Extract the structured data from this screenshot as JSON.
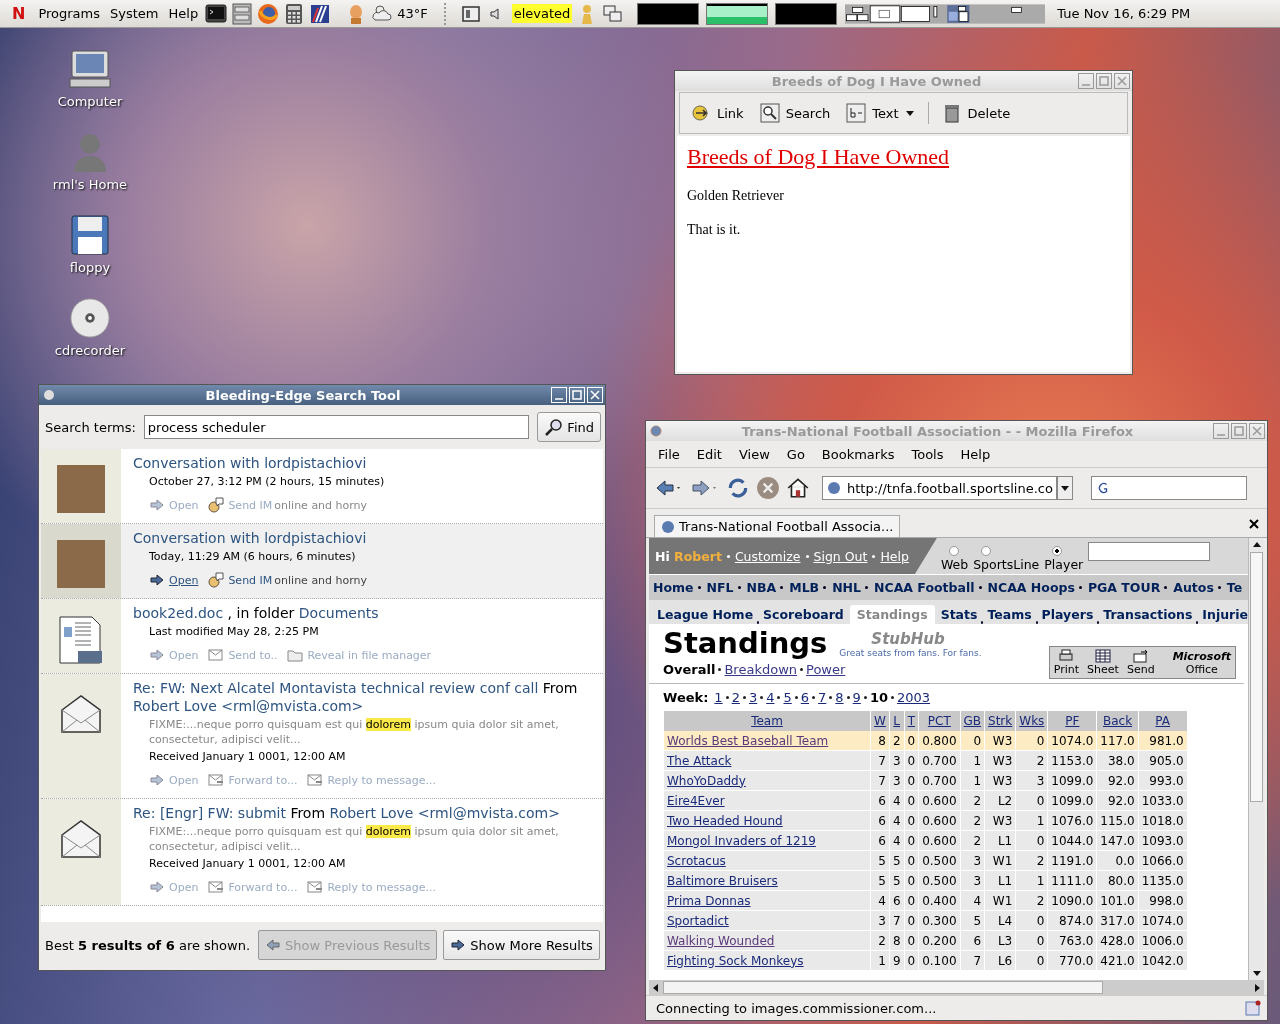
{
  "panel": {
    "logo": "N",
    "menus": [
      "Programs",
      "System",
      "Help"
    ],
    "temperature": "43°F",
    "status_label": "elevated",
    "workspaces": [
      {
        "selected": false
      },
      {
        "selected": true
      },
      {
        "selected": false
      }
    ],
    "clock": "Tue Nov 16,  6:29 PM"
  },
  "desktop_icons": [
    {
      "label": "Computer",
      "kind": "computer"
    },
    {
      "label": "rml's Home",
      "kind": "home"
    },
    {
      "label": "floppy",
      "kind": "floppy"
    },
    {
      "label": "cdrecorder",
      "kind": "cdrom"
    }
  ],
  "note_window": {
    "title": "Breeds of Dog I Have Owned",
    "toolbar": [
      {
        "label": "Link",
        "kind": "link",
        "menu": false
      },
      {
        "label": "Search",
        "kind": "search",
        "menu": false
      },
      {
        "label": "Text",
        "kind": "text",
        "menu": true
      },
      {
        "label": "Delete",
        "kind": "delete",
        "menu": false
      }
    ],
    "heading": "Breeds of Dog I Have Owned",
    "paragraphs": [
      "Golden Retriever",
      "That is it."
    ]
  },
  "search_window": {
    "title": "Bleeding-Edge Search Tool",
    "search_label": "Search terms:",
    "search_value": "process scheduler",
    "find_label": "Find",
    "results": [
      {
        "kind": "conversation",
        "selected": false,
        "title": [
          {
            "text": "Conversation with lordpistachiovi",
            "link": true
          }
        ],
        "meta": "October 27, 3:12 PM (2 hours, 15 minutes)",
        "actions": [
          {
            "label": "Open",
            "kind": "open"
          },
          {
            "label": "Send IM",
            "kind": "im",
            "note": "online and horny"
          }
        ]
      },
      {
        "kind": "conversation",
        "selected": true,
        "title": [
          {
            "text": "Conversation with lordpistachiovi",
            "link": true
          }
        ],
        "meta": "Today, 11:29 AM (6 hours, 6 minutes)",
        "actions": [
          {
            "label": "Open",
            "kind": "open"
          },
          {
            "label": "Send IM",
            "kind": "im",
            "note": "online and horny"
          }
        ]
      },
      {
        "kind": "document",
        "selected": false,
        "title": [
          {
            "text": "book2ed.doc",
            "link": true
          },
          {
            "text": ", in folder",
            "link": false
          },
          {
            "text": "Documents",
            "link": true
          }
        ],
        "meta": "Last modified May 28, 2:25 PM",
        "actions": [
          {
            "label": "Open",
            "kind": "open"
          },
          {
            "label": "Send to..",
            "kind": "send"
          },
          {
            "label": "Reveal in file manager",
            "kind": "folder"
          }
        ]
      },
      {
        "kind": "mail",
        "selected": false,
        "title": [
          {
            "text": "Re: FW: Next Alcatel Montavista technical review conf call",
            "link": true
          },
          {
            "text": "From",
            "link": false
          },
          {
            "text": "Robert Love <rml@mvista.com>",
            "link": true
          }
        ],
        "snippet": [
          {
            "text": "FIXME:...neque porro quisquam est qui",
            "highlight": false
          },
          {
            "text": "dolorem",
            "highlight": true
          },
          {
            "text": "ipsum quia dolor sit amet, consectetur, adipisci velit...",
            "highlight": false
          }
        ],
        "meta": "Received January 1 0001, 12:00 AM",
        "actions": [
          {
            "label": "Open",
            "kind": "open"
          },
          {
            "label": "Forward to...",
            "kind": "forward"
          },
          {
            "label": "Reply to message...",
            "kind": "reply"
          }
        ]
      },
      {
        "kind": "mail",
        "selected": false,
        "title": [
          {
            "text": "Re: [Engr] FW: submit",
            "link": true
          },
          {
            "text": "From",
            "link": false
          },
          {
            "text": "Robert Love <rml@mvista.com>",
            "link": true
          }
        ],
        "snippet": [
          {
            "text": "FIXME:...neque porro quisquam est qui",
            "highlight": false
          },
          {
            "text": "dolorem",
            "highlight": true
          },
          {
            "text": "ipsum quia dolor sit amet, consectetur, adipisci velit...",
            "highlight": false
          }
        ],
        "meta": "Received January 1 0001, 12:00 AM",
        "actions": [
          {
            "label": "Open",
            "kind": "open"
          },
          {
            "label": "Forward to...",
            "kind": "forward"
          },
          {
            "label": "Reply to message...",
            "kind": "reply"
          }
        ]
      }
    ],
    "footer": "Best **5 results of 6** are shown.",
    "buttons": [
      {
        "label": "Show Previous Results",
        "kind": "previous",
        "disabled": true
      },
      {
        "label": "Show More Results",
        "kind": "next",
        "disabled": false
      }
    ]
  },
  "firefox": {
    "title": "Trans-National Football Association - - Mozilla Firefox",
    "menus": [
      "File",
      "Edit",
      "View",
      "Go",
      "Bookmarks",
      "Tools",
      "Help"
    ],
    "url": "http://tnfa.football.sportsline.co",
    "tab": "Trans-National Football Associa...",
    "site": {
      "greeting": "Hi",
      "user": "Robert",
      "account_links": [
        "Customize",
        "Sign Out",
        "Help"
      ],
      "scopes": [
        {
          "label": "Web",
          "selected": false
        },
        {
          "label": "SportsLine",
          "selected": false
        },
        {
          "label": "Player",
          "selected": true
        }
      ],
      "nav": [
        "Home",
        "NFL",
        "NBA",
        "MLB",
        "NHL",
        "NCAA Football",
        "NCAA Hoops",
        "PGA TOUR",
        "Autos",
        "Te"
      ],
      "subnav": [
        {
          "label": "League Home",
          "selected": false
        },
        {
          "label": "Scoreboard",
          "selected": false
        },
        {
          "label": "Standings",
          "selected": true
        },
        {
          "label": "Stats",
          "selected": false
        },
        {
          "label": "Teams",
          "selected": false
        },
        {
          "label": "Players",
          "selected": false
        },
        {
          "label": "Transactions",
          "selected": false
        },
        {
          "label": "Injurie",
          "selected": false
        }
      ],
      "heading": "Standings",
      "sponsor_logo": "StubHub",
      "sponsor_tagline": "Great seats from fans. For fans.",
      "views": [
        {
          "label": "Overall",
          "selected": true
        },
        {
          "label": "Breakdown",
          "selected": false
        },
        {
          "label": "Power",
          "selected": false
        }
      ],
      "tools": [
        {
          "label": "Print",
          "kind": "print"
        },
        {
          "label": "Sheet",
          "kind": "sheet"
        },
        {
          "label": "Send",
          "kind": "send"
        }
      ],
      "office_logo": [
        "Microsoft",
        "Office"
      ],
      "week_label": "Week:",
      "weeks": [
        {
          "label": "1",
          "selected": false
        },
        {
          "label": "2",
          "selected": false
        },
        {
          "label": "3",
          "selected": false
        },
        {
          "label": "4",
          "selected": false
        },
        {
          "label": "5",
          "selected": false
        },
        {
          "label": "6",
          "selected": false
        },
        {
          "label": "7",
          "selected": false
        },
        {
          "label": "8",
          "selected": false
        },
        {
          "label": "9",
          "selected": false
        },
        {
          "label": "10",
          "selected": true
        },
        {
          "label": "2003",
          "selected": false
        }
      ],
      "table": {
        "columns": [
          "Team",
          "W",
          "L",
          "T",
          "PCT",
          "GB",
          "Strk",
          "Wks",
          "PF",
          "Back",
          "PA"
        ],
        "rows": [
          {
            "highlighted": true,
            "visited": true,
            "cells": [
              "Worlds Best Baseball Team",
              "8",
              "2",
              "0",
              "0.800",
              "0",
              "W3",
              "0",
              "1074.0",
              "117.0",
              "981.0"
            ]
          },
          {
            "highlighted": false,
            "visited": false,
            "cells": [
              "The Attack",
              "7",
              "3",
              "0",
              "0.700",
              "1",
              "W3",
              "2",
              "1153.0",
              "38.0",
              "905.0"
            ]
          },
          {
            "highlighted": false,
            "visited": false,
            "cells": [
              "WhoYoDaddy",
              "7",
              "3",
              "0",
              "0.700",
              "1",
              "W3",
              "3",
              "1099.0",
              "92.0",
              "993.0"
            ]
          },
          {
            "highlighted": false,
            "visited": false,
            "cells": [
              "Eire4Ever",
              "6",
              "4",
              "0",
              "0.600",
              "2",
              "L2",
              "0",
              "1099.0",
              "92.0",
              "1033.0"
            ]
          },
          {
            "highlighted": false,
            "visited": false,
            "cells": [
              "Two Headed Hound",
              "6",
              "4",
              "0",
              "0.600",
              "2",
              "W3",
              "1",
              "1076.0",
              "115.0",
              "1018.0"
            ]
          },
          {
            "highlighted": false,
            "visited": false,
            "cells": [
              "Mongol Invaders of 1219",
              "6",
              "4",
              "0",
              "0.600",
              "2",
              "L1",
              "0",
              "1044.0",
              "147.0",
              "1093.0"
            ]
          },
          {
            "highlighted": false,
            "visited": false,
            "cells": [
              "Scrotacus",
              "5",
              "5",
              "0",
              "0.500",
              "3",
              "W1",
              "2",
              "1191.0",
              "0.0",
              "1066.0"
            ]
          },
          {
            "highlighted": false,
            "visited": false,
            "cells": [
              "Baltimore Bruisers",
              "5",
              "5",
              "0",
              "0.500",
              "3",
              "L1",
              "1",
              "1111.0",
              "80.0",
              "1135.0"
            ]
          },
          {
            "highlighted": false,
            "visited": false,
            "cells": [
              "Prima Donnas",
              "4",
              "6",
              "0",
              "0.400",
              "4",
              "W1",
              "2",
              "1090.0",
              "101.0",
              "998.0"
            ]
          },
          {
            "highlighted": false,
            "visited": false,
            "cells": [
              "Sportadict",
              "3",
              "7",
              "0",
              "0.300",
              "5",
              "L4",
              "0",
              "874.0",
              "317.0",
              "1074.0"
            ]
          },
          {
            "highlighted": false,
            "visited": true,
            "cells": [
              "Walking Wounded",
              "2",
              "8",
              "0",
              "0.200",
              "6",
              "L3",
              "0",
              "763.0",
              "428.0",
              "1006.0"
            ]
          },
          {
            "highlighted": false,
            "visited": false,
            "cells": [
              "Fighting Sock Monkeys",
              "1",
              "9",
              "0",
              "0.100",
              "7",
              "L6",
              "0",
              "770.0",
              "421.0",
              "1042.0"
            ]
          }
        ]
      }
    },
    "status_bar": "Connecting to images.commissioner.com..."
  }
}
